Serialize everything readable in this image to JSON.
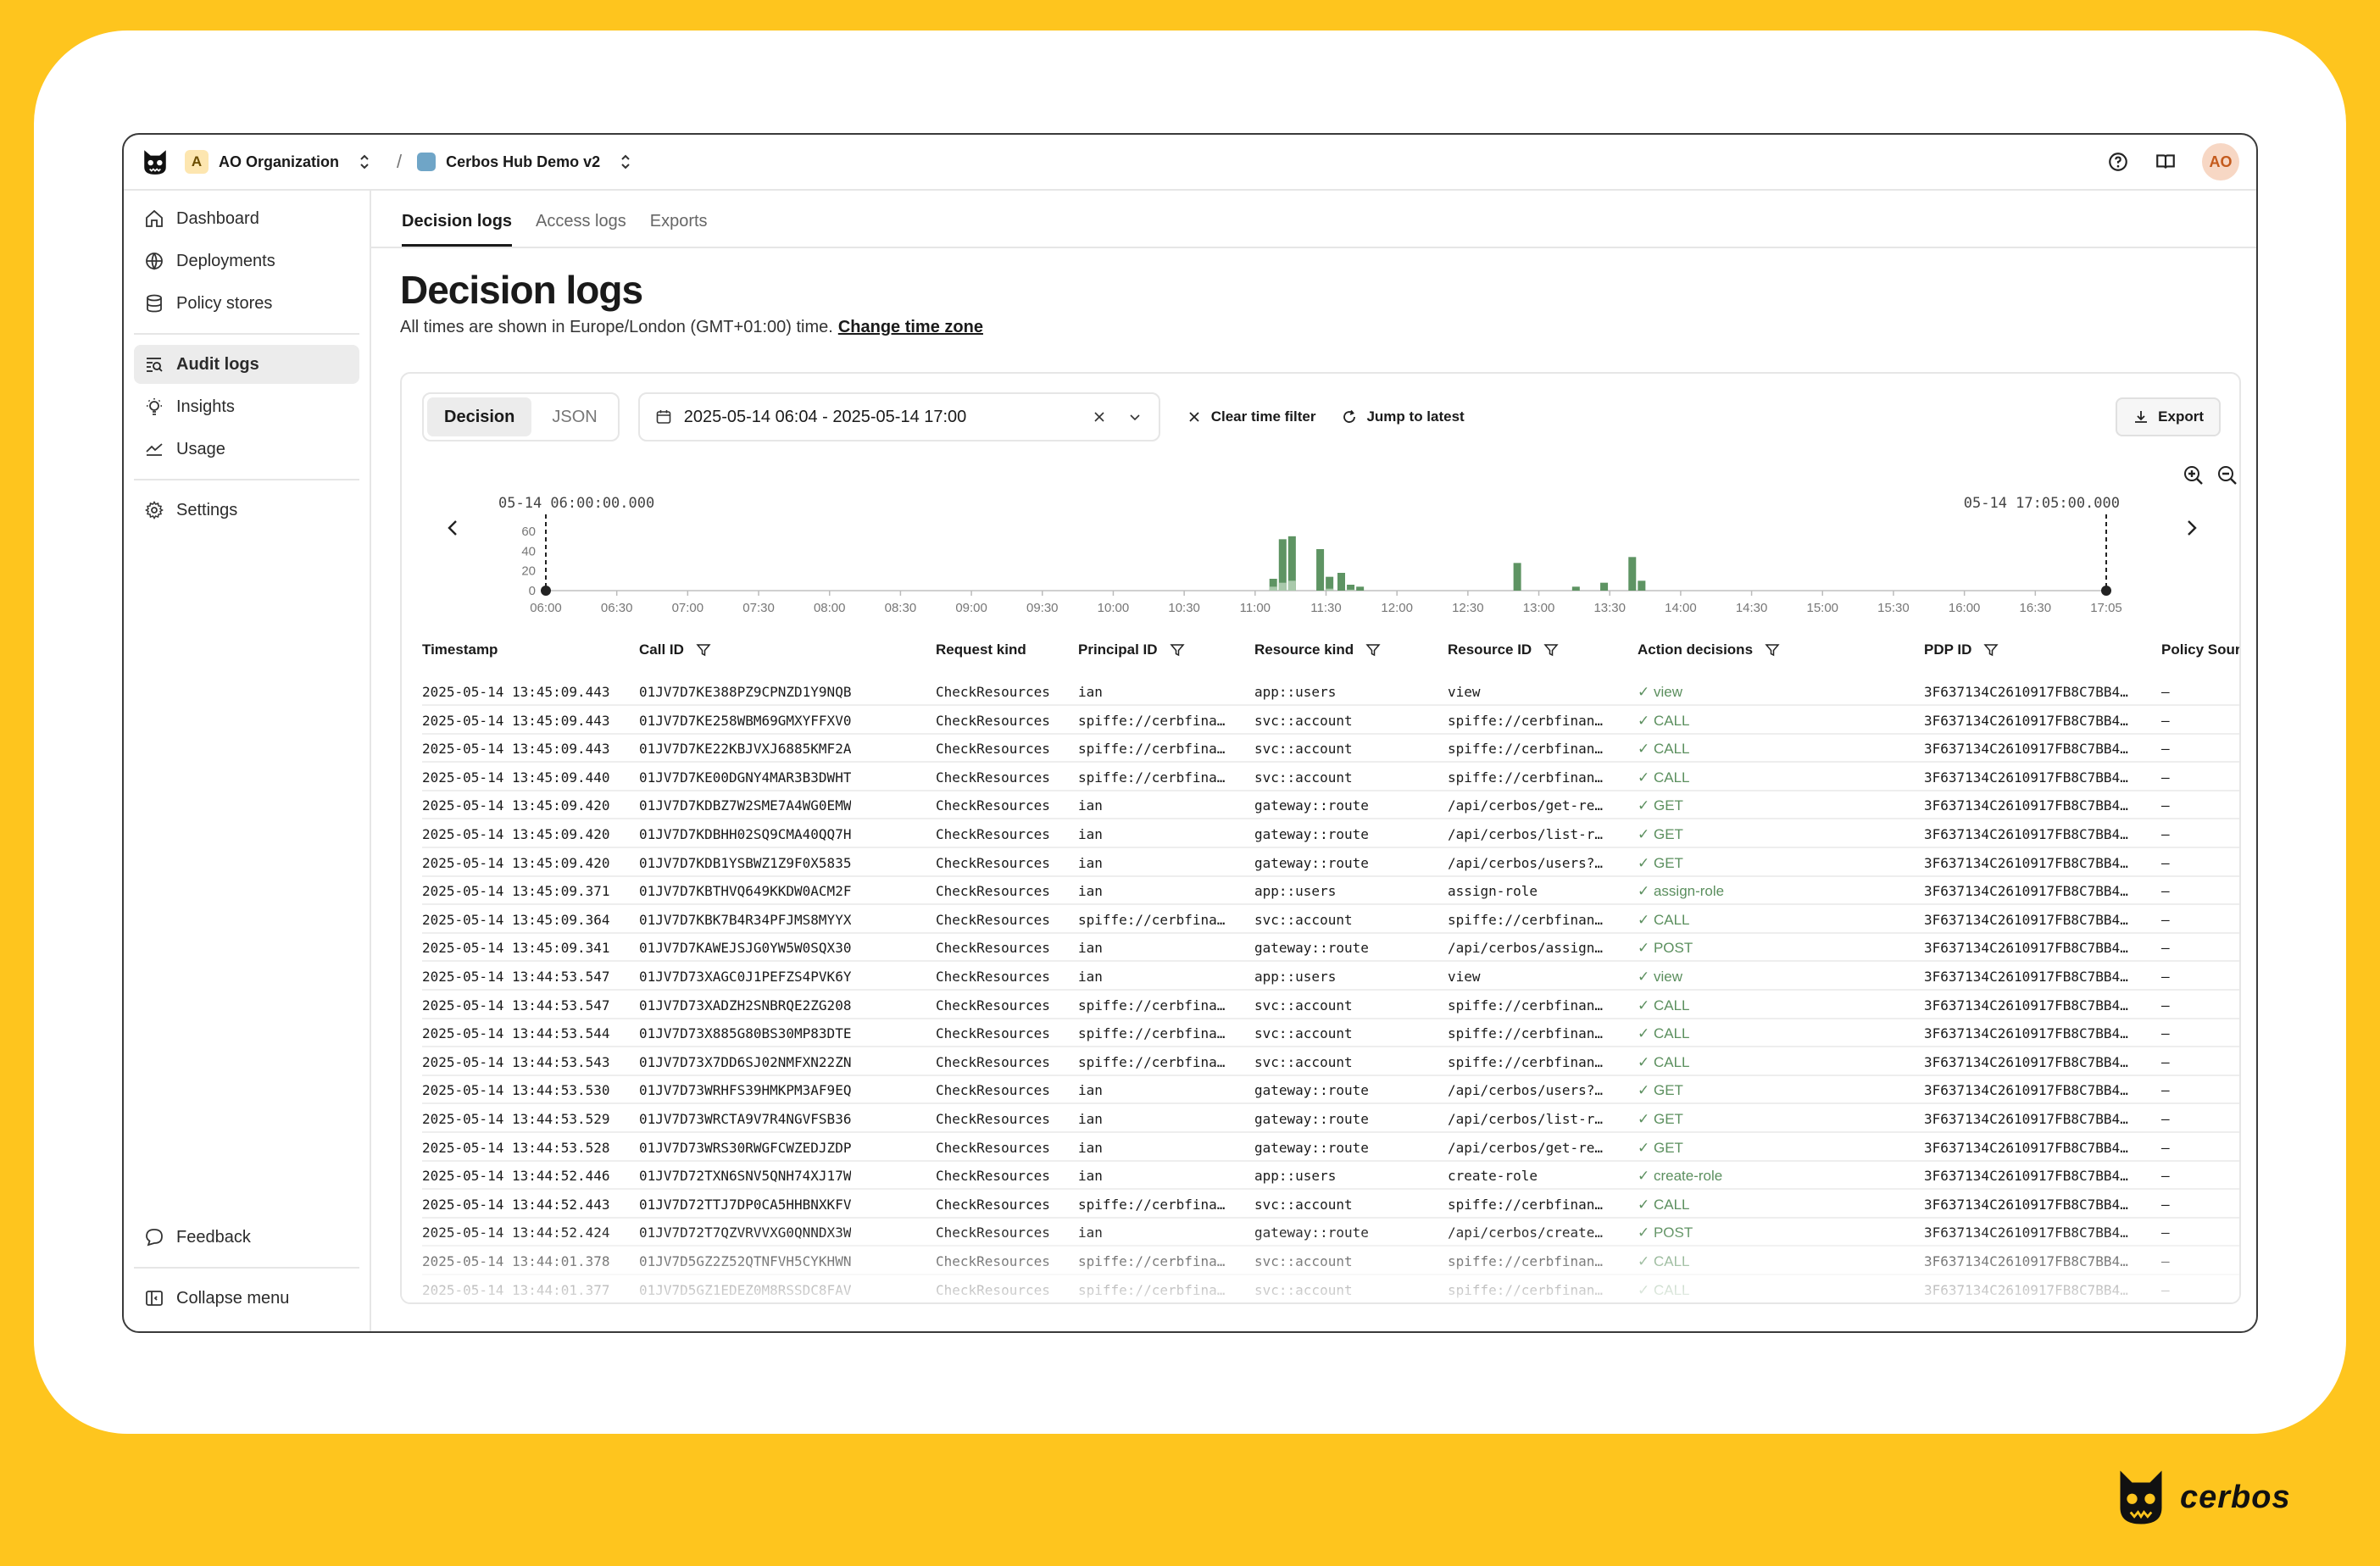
{
  "header": {
    "org_badge": "A",
    "org_name": "AO Organization",
    "separator": "/",
    "project_name": "Cerbos Hub Demo v2",
    "avatar": "AO",
    "icons": [
      "help-icon",
      "docs-book-icon"
    ]
  },
  "sidebar": {
    "items": [
      {
        "label": "Dashboard",
        "icon": "home-icon"
      },
      {
        "label": "Deployments",
        "icon": "globe-icon"
      },
      {
        "label": "Policy stores",
        "icon": "database-icon"
      },
      {
        "label": "Audit logs",
        "icon": "audit-log-icon",
        "active": true
      },
      {
        "label": "Insights",
        "icon": "lightbulb-icon"
      },
      {
        "label": "Usage",
        "icon": "trend-icon"
      },
      {
        "label": "Settings",
        "icon": "gear-icon"
      }
    ],
    "feedback": "Feedback",
    "collapse": "Collapse menu"
  },
  "tabs": [
    "Decision logs",
    "Access logs",
    "Exports"
  ],
  "page": {
    "title": "Decision logs",
    "subtitle": "All times are shown in Europe/London (GMT+01:00) time.",
    "change_tz": "Change time zone"
  },
  "toolbar": {
    "view_decision": "Decision",
    "view_json": "JSON",
    "date_range": "2025-05-14 06:04 - 2025-05-14 17:00",
    "clear_filter": "Clear time filter",
    "jump_latest": "Jump to latest",
    "export": "Export"
  },
  "chart_data": {
    "type": "bar",
    "range_start_label": "05-14 06:00:00.000",
    "range_end_label": "05-14 17:05:00.000",
    "y_ticks": [
      "60",
      "40",
      "20",
      "0"
    ],
    "ylim": [
      0,
      60
    ],
    "x_ticks": [
      "06:00",
      "06:30",
      "07:00",
      "07:30",
      "08:00",
      "08:30",
      "09:00",
      "09:30",
      "10:00",
      "10:30",
      "11:00",
      "11:30",
      "12:00",
      "12:30",
      "13:00",
      "13:30",
      "14:00",
      "14:30",
      "15:00",
      "15:30",
      "16:00",
      "16:30",
      "17:05"
    ],
    "x_minutes_range": [
      360,
      1025
    ],
    "bars": [
      {
        "t": 670,
        "total": 12,
        "deny": 4
      },
      {
        "t": 674,
        "total": 52,
        "deny": 8
      },
      {
        "t": 678,
        "total": 55,
        "deny": 10
      },
      {
        "t": 690,
        "total": 42,
        "deny": 0
      },
      {
        "t": 694,
        "total": 14,
        "deny": 2
      },
      {
        "t": 699,
        "total": 18,
        "deny": 0
      },
      {
        "t": 703,
        "total": 6,
        "deny": 1
      },
      {
        "t": 707,
        "total": 4,
        "deny": 0
      },
      {
        "t": 774,
        "total": 28,
        "deny": 0
      },
      {
        "t": 799,
        "total": 4,
        "deny": 0
      },
      {
        "t": 811,
        "total": 8,
        "deny": 0
      },
      {
        "t": 823,
        "total": 34,
        "deny": 0
      },
      {
        "t": 827,
        "total": 10,
        "deny": 0
      }
    ],
    "colors": {
      "allow": "#5e9463",
      "deny": "#a9c9ab"
    }
  },
  "table": {
    "columns": [
      "Timestamp",
      "Call ID",
      "Request kind",
      "Principal ID",
      "Resource kind",
      "Resource ID",
      "Action decisions",
      "PDP ID",
      "Policy Sour"
    ],
    "rows": [
      [
        "2025-05-14 13:45:09.443",
        "01JV7D7KE388PZ9CPNZD1Y9NQB",
        "CheckResources",
        "ian",
        "app::users",
        "view",
        "view",
        "3F637134C2610917FB8C7BB4…",
        "—"
      ],
      [
        "2025-05-14 13:45:09.443",
        "01JV7D7KE258WBM69GMXYFFXV0",
        "CheckResources",
        "spiffe://cerbfina…",
        "svc::account",
        "spiffe://cerbfinan…",
        "CALL",
        "3F637134C2610917FB8C7BB4…",
        "—"
      ],
      [
        "2025-05-14 13:45:09.443",
        "01JV7D7KE22KBJVXJ6885KMF2A",
        "CheckResources",
        "spiffe://cerbfina…",
        "svc::account",
        "spiffe://cerbfinan…",
        "CALL",
        "3F637134C2610917FB8C7BB4…",
        "—"
      ],
      [
        "2025-05-14 13:45:09.440",
        "01JV7D7KE00DGNY4MAR3B3DWHT",
        "CheckResources",
        "spiffe://cerbfina…",
        "svc::account",
        "spiffe://cerbfinan…",
        "CALL",
        "3F637134C2610917FB8C7BB4…",
        "—"
      ],
      [
        "2025-05-14 13:45:09.420",
        "01JV7D7KDBZ7W2SME7A4WG0EMW",
        "CheckResources",
        "ian",
        "gateway::route",
        "/api/cerbos/get-re…",
        "GET",
        "3F637134C2610917FB8C7BB4…",
        "—"
      ],
      [
        "2025-05-14 13:45:09.420",
        "01JV7D7KDBHH02SQ9CMA40QQ7H",
        "CheckResources",
        "ian",
        "gateway::route",
        "/api/cerbos/list-r…",
        "GET",
        "3F637134C2610917FB8C7BB4…",
        "—"
      ],
      [
        "2025-05-14 13:45:09.420",
        "01JV7D7KDB1YSBWZ1Z9F0X5835",
        "CheckResources",
        "ian",
        "gateway::route",
        "/api/cerbos/users?…",
        "GET",
        "3F637134C2610917FB8C7BB4…",
        "—"
      ],
      [
        "2025-05-14 13:45:09.371",
        "01JV7D7KBTHVQ649KKDW0ACM2F",
        "CheckResources",
        "ian",
        "app::users",
        "assign-role",
        "assign-role",
        "3F637134C2610917FB8C7BB4…",
        "—"
      ],
      [
        "2025-05-14 13:45:09.364",
        "01JV7D7KBK7B4R34PFJMS8MYYX",
        "CheckResources",
        "spiffe://cerbfina…",
        "svc::account",
        "spiffe://cerbfinan…",
        "CALL",
        "3F637134C2610917FB8C7BB4…",
        "—"
      ],
      [
        "2025-05-14 13:45:09.341",
        "01JV7D7KAWEJSJG0YW5W0SQX30",
        "CheckResources",
        "ian",
        "gateway::route",
        "/api/cerbos/assign…",
        "POST",
        "3F637134C2610917FB8C7BB4…",
        "—"
      ],
      [
        "2025-05-14 13:44:53.547",
        "01JV7D73XAGC0J1PEFZS4PVK6Y",
        "CheckResources",
        "ian",
        "app::users",
        "view",
        "view",
        "3F637134C2610917FB8C7BB4…",
        "—"
      ],
      [
        "2025-05-14 13:44:53.547",
        "01JV7D73XADZH2SNBRQE2ZG208",
        "CheckResources",
        "spiffe://cerbfina…",
        "svc::account",
        "spiffe://cerbfinan…",
        "CALL",
        "3F637134C2610917FB8C7BB4…",
        "—"
      ],
      [
        "2025-05-14 13:44:53.544",
        "01JV7D73X885G80BS30MP83DTE",
        "CheckResources",
        "spiffe://cerbfina…",
        "svc::account",
        "spiffe://cerbfinan…",
        "CALL",
        "3F637134C2610917FB8C7BB4…",
        "—"
      ],
      [
        "2025-05-14 13:44:53.543",
        "01JV7D73X7DD6SJ02NMFXN22ZN",
        "CheckResources",
        "spiffe://cerbfina…",
        "svc::account",
        "spiffe://cerbfinan…",
        "CALL",
        "3F637134C2610917FB8C7BB4…",
        "—"
      ],
      [
        "2025-05-14 13:44:53.530",
        "01JV7D73WRHFS39HMKPM3AF9EQ",
        "CheckResources",
        "ian",
        "gateway::route",
        "/api/cerbos/users?…",
        "GET",
        "3F637134C2610917FB8C7BB4…",
        "—"
      ],
      [
        "2025-05-14 13:44:53.529",
        "01JV7D73WRCTA9V7R4NGVFSB36",
        "CheckResources",
        "ian",
        "gateway::route",
        "/api/cerbos/list-r…",
        "GET",
        "3F637134C2610917FB8C7BB4…",
        "—"
      ],
      [
        "2025-05-14 13:44:53.528",
        "01JV7D73WRS30RWGFCWZEDJZDP",
        "CheckResources",
        "ian",
        "gateway::route",
        "/api/cerbos/get-re…",
        "GET",
        "3F637134C2610917FB8C7BB4…",
        "—"
      ],
      [
        "2025-05-14 13:44:52.446",
        "01JV7D72TXN6SNV5QNH74XJ17W",
        "CheckResources",
        "ian",
        "app::users",
        "create-role",
        "create-role",
        "3F637134C2610917FB8C7BB4…",
        "—"
      ],
      [
        "2025-05-14 13:44:52.443",
        "01JV7D72TTJ7DP0CA5HHBNXKFV",
        "CheckResources",
        "spiffe://cerbfina…",
        "svc::account",
        "spiffe://cerbfinan…",
        "CALL",
        "3F637134C2610917FB8C7BB4…",
        "—"
      ],
      [
        "2025-05-14 13:44:52.424",
        "01JV7D72T7QZVRVVXG0QNNDX3W",
        "CheckResources",
        "ian",
        "gateway::route",
        "/api/cerbos/create…",
        "POST",
        "3F637134C2610917FB8C7BB4…",
        "—"
      ],
      [
        "2025-05-14 13:44:01.378",
        "01JV7D5GZ2Z52QTNFVH5CYKHWN",
        "CheckResources",
        "spiffe://cerbfina…",
        "svc::account",
        "spiffe://cerbfinan…",
        "CALL",
        "3F637134C2610917FB8C7BB4…",
        "—"
      ],
      [
        "2025-05-14 13:44:01.377",
        "01JV7D5GZ1EDEZ0M8RSSDC8FAV",
        "CheckResources",
        "spiffe://cerbfina…",
        "svc::account",
        "spiffe://cerbfinan…",
        "CALL",
        "3F637134C2610917FB8C7BB4…",
        "—"
      ]
    ]
  },
  "brand": {
    "name": "cerbos"
  },
  "colors": {
    "accent": "#fec51e",
    "allow_green": "#5b8f5e"
  }
}
